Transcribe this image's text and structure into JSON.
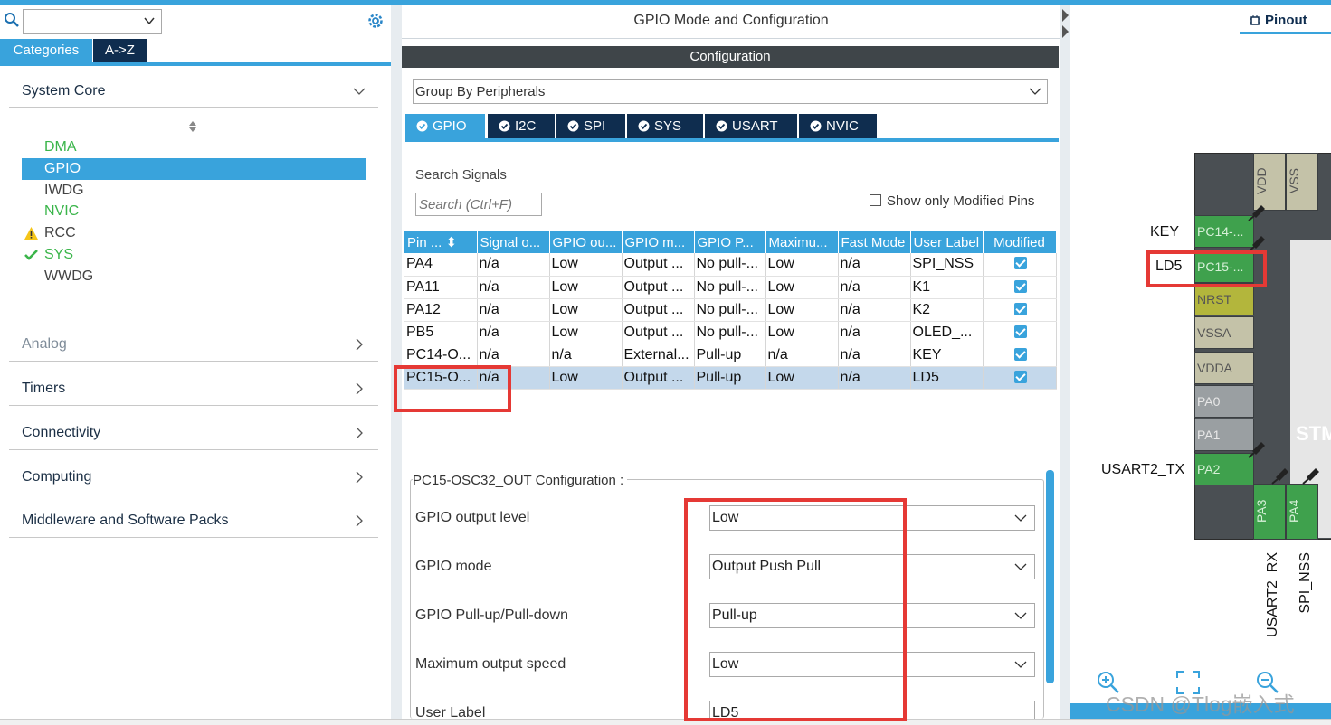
{
  "colors": {
    "accent": "#39a3dc",
    "navy": "#0f2d4f",
    "annotation_red": "#e53935",
    "pin_green": "#3fa14d"
  },
  "left": {
    "search_value": "",
    "tabs": [
      "Categories",
      "A->Z"
    ],
    "sections": {
      "system_core": "System Core",
      "analog": "Analog",
      "timers": "Timers",
      "connectivity": "Connectivity",
      "computing": "Computing",
      "middleware": "Middleware and Software Packs"
    },
    "core_items": [
      {
        "label": "DMA",
        "state": "green"
      },
      {
        "label": "GPIO",
        "state": "selected"
      },
      {
        "label": "IWDG",
        "state": "normal"
      },
      {
        "label": "NVIC",
        "state": "green"
      },
      {
        "label": "RCC",
        "state": "warning",
        "icon": "warning-icon"
      },
      {
        "label": "SYS",
        "state": "ok",
        "icon": "check-icon"
      },
      {
        "label": "WWDG",
        "state": "normal"
      }
    ]
  },
  "middle": {
    "title": "GPIO Mode and Configuration",
    "config_bar": "Configuration",
    "group_by": "Group By Peripherals",
    "tabs": [
      "GPIO",
      "I2C",
      "SPI",
      "SYS",
      "USART",
      "NVIC"
    ],
    "search_signals_label": "Search Signals",
    "search_placeholder": "Search (Ctrl+F)",
    "show_modified": "Show only Modified Pins",
    "table": {
      "headers": [
        "Pin ...",
        "Signal o...",
        "GPIO ou...",
        "GPIO m...",
        "GPIO P...",
        "Maximu...",
        "Fast Mode",
        "User Label",
        "Modified"
      ],
      "rows": [
        [
          "PA4",
          "n/a",
          "Low",
          "Output ...",
          "No pull-...",
          "Low",
          "n/a",
          "SPI_NSS"
        ],
        [
          "PA11",
          "n/a",
          "Low",
          "Output ...",
          "No pull-...",
          "Low",
          "n/a",
          "K1"
        ],
        [
          "PA12",
          "n/a",
          "Low",
          "Output ...",
          "No pull-...",
          "Low",
          "n/a",
          "K2"
        ],
        [
          "PB5",
          "n/a",
          "Low",
          "Output ...",
          "No pull-...",
          "Low",
          "n/a",
          "OLED_..."
        ],
        [
          "PC14-O...",
          "n/a",
          "n/a",
          "External...",
          "Pull-up",
          "n/a",
          "n/a",
          "KEY"
        ],
        [
          "PC15-O...",
          "n/a",
          "Low",
          "Output ...",
          "Pull-up",
          "Low",
          "n/a",
          "LD5"
        ]
      ],
      "selected_row": 5
    },
    "pin_config": {
      "legend": "PC15-OSC32_OUT Configuration :",
      "props": [
        {
          "label": "GPIO output level",
          "value": "Low"
        },
        {
          "label": "GPIO mode",
          "value": "Output Push Pull"
        },
        {
          "label": "GPIO Pull-up/Pull-down",
          "value": "Pull-up"
        },
        {
          "label": "Maximum output speed",
          "value": "Low"
        },
        {
          "label": "User Label",
          "value": "LD5"
        }
      ]
    }
  },
  "right": {
    "tab": "Pinout",
    "pins_left": [
      "PC14-...",
      "PC15-...",
      "NRST",
      "VSSA",
      "VDDA",
      "PA0",
      "PA1",
      "PA2"
    ],
    "pins_top": [
      "VDD",
      "VSS"
    ],
    "pins_bottom": [
      "PA3",
      "PA4"
    ],
    "chip_text": "STM",
    "ext_labels": {
      "key": "KEY",
      "ld5": "LD5",
      "usart2_tx": "USART2_TX",
      "usart2_rx": "USART2_RX",
      "spi_nss": "SPI_NSS"
    },
    "watermark": "CSDN @Tlog嵌入式"
  }
}
